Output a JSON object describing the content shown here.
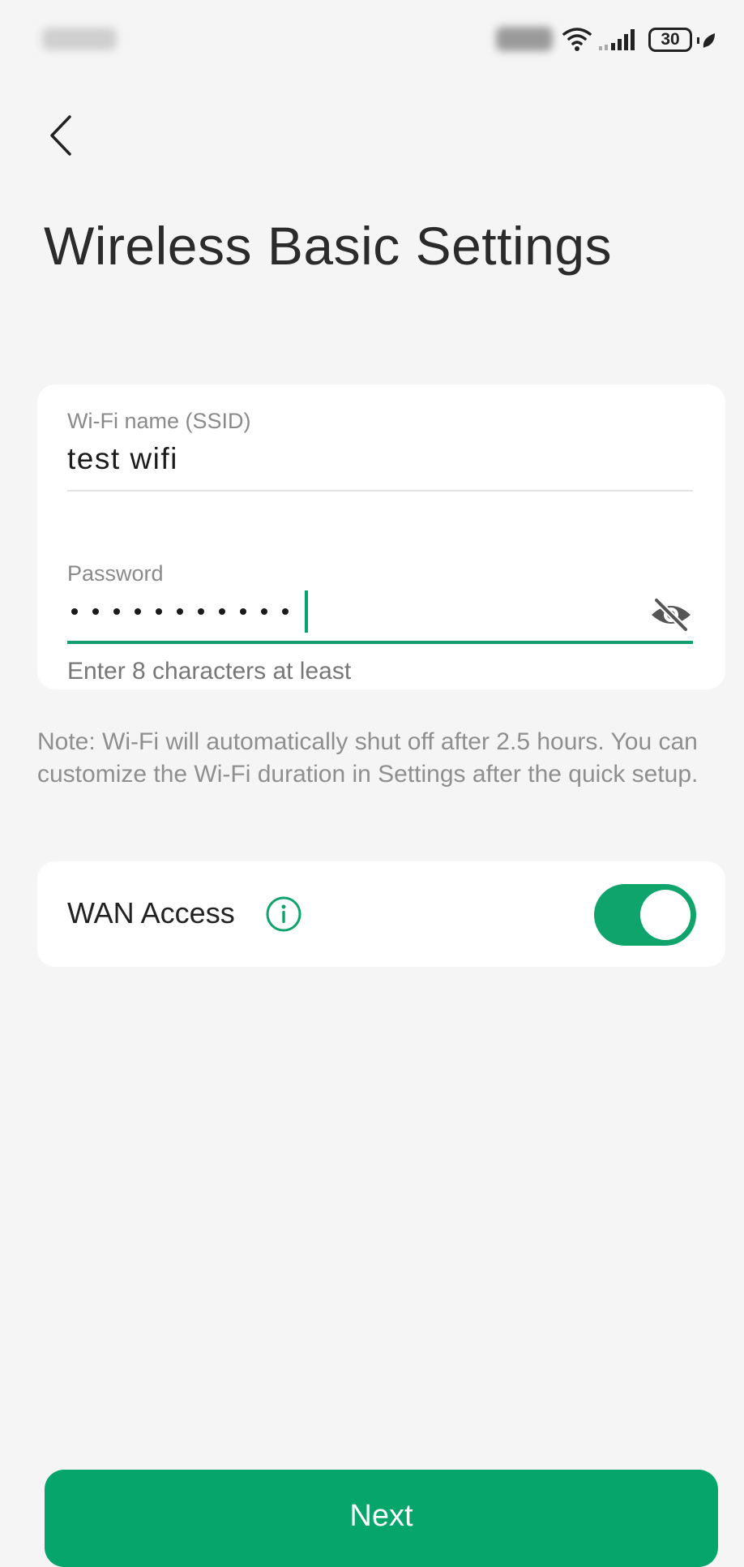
{
  "status_bar": {
    "battery_level": "30"
  },
  "header": {
    "title": "Wireless Basic Settings"
  },
  "form": {
    "ssid_label": "Wi-Fi name (SSID)",
    "ssid_value": "test wifi",
    "password_label": "Password",
    "password_hint": "Enter 8 characters at least"
  },
  "note": {
    "text": "Note: Wi-Fi will automatically shut off after 2.5 hours. You can customize the Wi-Fi duration in Settings after the quick setup."
  },
  "wan": {
    "label": "WAN Access",
    "enabled": true
  },
  "footer": {
    "next_label": "Next"
  },
  "icons": {
    "back": "chevron-left-icon",
    "password_visibility": "eye-off-icon",
    "wan_info": "info-icon"
  },
  "colors": {
    "accent": "#0fa46c",
    "background": "#f5f5f5",
    "card": "#ffffff"
  }
}
